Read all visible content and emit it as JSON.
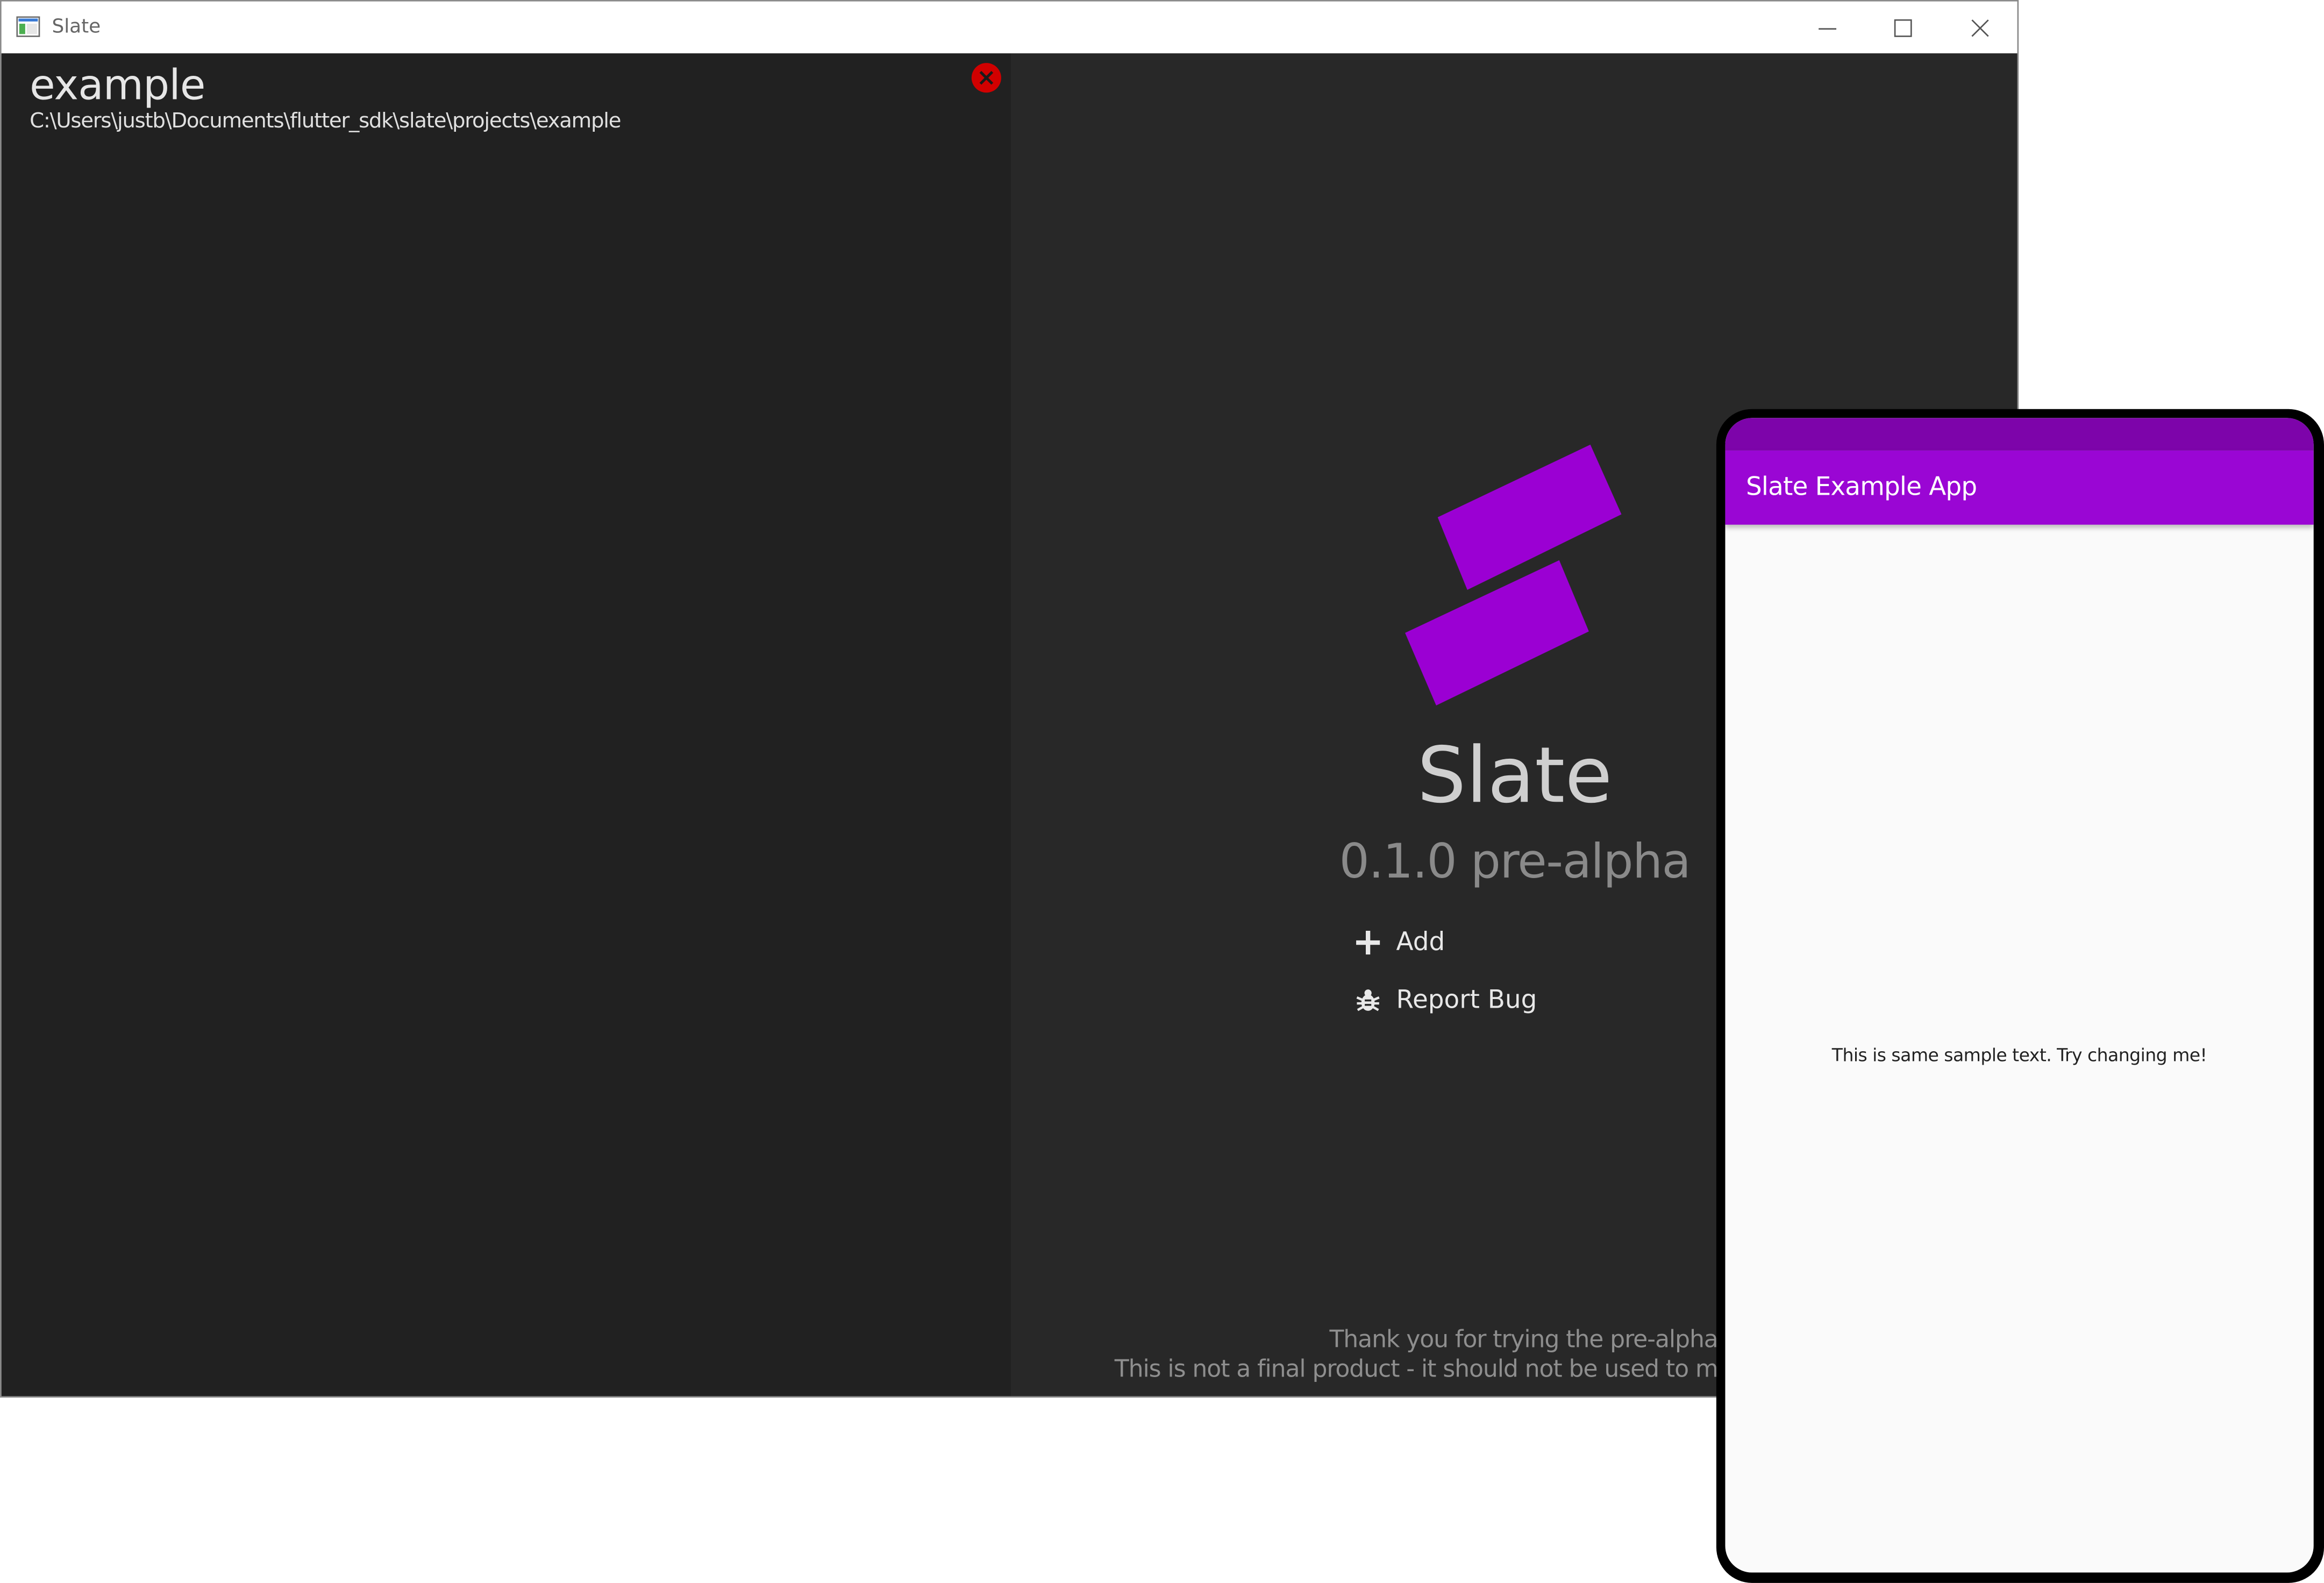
{
  "window": {
    "title": "Slate",
    "controls": [
      "minimize",
      "maximize",
      "close"
    ]
  },
  "project": {
    "name": "example",
    "path": "C:\\Users\\justb\\Documents\\flutter_sdk\\slate\\projects\\example"
  },
  "brand": {
    "name": "Slate",
    "version": "0.1.0 pre-alpha",
    "accent_color": "#9b00d3"
  },
  "actions": {
    "add_label": "Add",
    "report_bug_label": "Report Bug"
  },
  "footer": {
    "line1": "Thank you for trying the pre-alpha!",
    "line2": "This is not a final product - it should not be used to make"
  },
  "phone": {
    "app_bar_title": "Slate Example App",
    "body_text": "This is same sample text. Try changing me!",
    "status_bar_color": "#7d04aa",
    "app_bar_color": "#9a06d4"
  },
  "colors": {
    "left_panel_bg": "#212121",
    "right_panel_bg": "#282828",
    "remove_button": "#d10000"
  }
}
